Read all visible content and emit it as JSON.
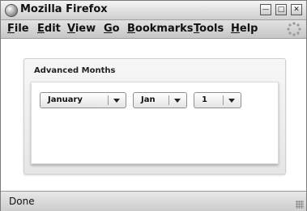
{
  "window": {
    "title": "Mozilla Firefox"
  },
  "menubar": {
    "items": [
      {
        "label": "File",
        "access": "F",
        "rest": "ile"
      },
      {
        "label": "Edit",
        "access": "E",
        "rest": "dit"
      },
      {
        "label": "View",
        "access": "V",
        "rest": "iew"
      },
      {
        "label": "Go",
        "access": "G",
        "rest": "o"
      },
      {
        "label": "Bookmarks",
        "access": "B",
        "rest": "ookmarks"
      },
      {
        "label": "Tools",
        "access": "T",
        "rest": "ools"
      },
      {
        "label": "Help",
        "access": "H",
        "rest": "elp"
      }
    ]
  },
  "content": {
    "group_title": "Advanced Months",
    "dropdowns": [
      {
        "value": "January"
      },
      {
        "value": "Jan"
      },
      {
        "value": "1"
      }
    ]
  },
  "statusbar": {
    "text": "Done"
  },
  "icons": {
    "app": "firefox-globe-icon",
    "throbber": "throbber-icon",
    "minimize": "minimize-icon",
    "maximize": "maximize-icon",
    "close": "close-icon",
    "dropdown_arrow": "chevron-down-icon",
    "resize": "resize-grip-icon"
  }
}
